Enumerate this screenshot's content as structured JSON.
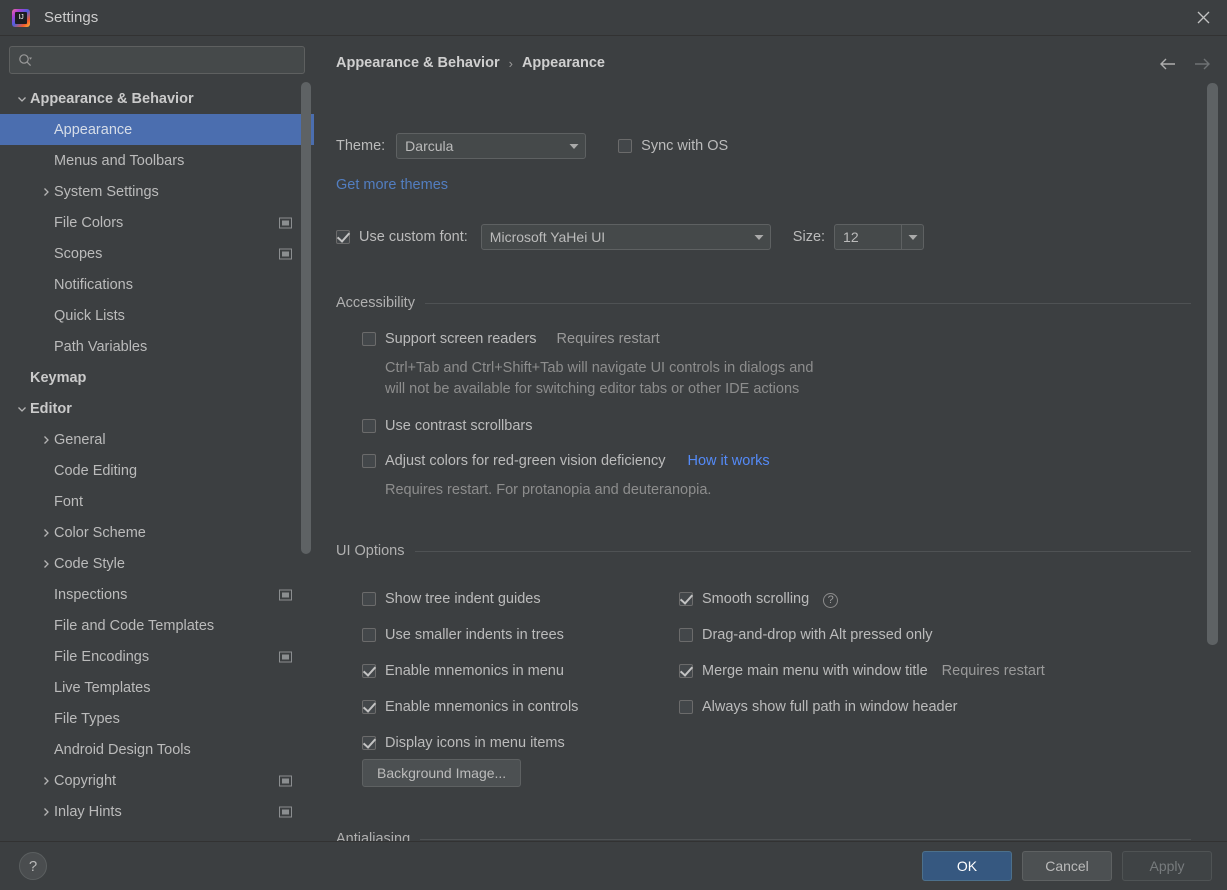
{
  "window": {
    "title": "Settings",
    "logo_text": "IJ",
    "close_icon": "close-icon"
  },
  "sidebar": {
    "search": {
      "value": "",
      "placeholder": "",
      "icon": "search-icon"
    },
    "items": [
      {
        "label": "Appearance & Behavior",
        "indent": 0,
        "bold": true,
        "twisty": "expanded",
        "selected": false,
        "project_icon": false
      },
      {
        "label": "Appearance",
        "indent": 1,
        "bold": false,
        "twisty": "none",
        "selected": true,
        "project_icon": false
      },
      {
        "label": "Menus and Toolbars",
        "indent": 1,
        "bold": false,
        "twisty": "none",
        "selected": false,
        "project_icon": false
      },
      {
        "label": "System Settings",
        "indent": 1,
        "bold": false,
        "twisty": "collapsed",
        "selected": false,
        "project_icon": false
      },
      {
        "label": "File Colors",
        "indent": 1,
        "bold": false,
        "twisty": "none",
        "selected": false,
        "project_icon": true
      },
      {
        "label": "Scopes",
        "indent": 1,
        "bold": false,
        "twisty": "none",
        "selected": false,
        "project_icon": true
      },
      {
        "label": "Notifications",
        "indent": 1,
        "bold": false,
        "twisty": "none",
        "selected": false,
        "project_icon": false
      },
      {
        "label": "Quick Lists",
        "indent": 1,
        "bold": false,
        "twisty": "none",
        "selected": false,
        "project_icon": false
      },
      {
        "label": "Path Variables",
        "indent": 1,
        "bold": false,
        "twisty": "none",
        "selected": false,
        "project_icon": false
      },
      {
        "label": "Keymap",
        "indent": 0,
        "bold": true,
        "twisty": "none",
        "selected": false,
        "project_icon": false
      },
      {
        "label": "Editor",
        "indent": 0,
        "bold": true,
        "twisty": "expanded",
        "selected": false,
        "project_icon": false
      },
      {
        "label": "General",
        "indent": 1,
        "bold": false,
        "twisty": "collapsed",
        "selected": false,
        "project_icon": false
      },
      {
        "label": "Code Editing",
        "indent": 1,
        "bold": false,
        "twisty": "none",
        "selected": false,
        "project_icon": false
      },
      {
        "label": "Font",
        "indent": 1,
        "bold": false,
        "twisty": "none",
        "selected": false,
        "project_icon": false
      },
      {
        "label": "Color Scheme",
        "indent": 1,
        "bold": false,
        "twisty": "collapsed",
        "selected": false,
        "project_icon": false
      },
      {
        "label": "Code Style",
        "indent": 1,
        "bold": false,
        "twisty": "collapsed",
        "selected": false,
        "project_icon": false
      },
      {
        "label": "Inspections",
        "indent": 1,
        "bold": false,
        "twisty": "none",
        "selected": false,
        "project_icon": true
      },
      {
        "label": "File and Code Templates",
        "indent": 1,
        "bold": false,
        "twisty": "none",
        "selected": false,
        "project_icon": false
      },
      {
        "label": "File Encodings",
        "indent": 1,
        "bold": false,
        "twisty": "none",
        "selected": false,
        "project_icon": true
      },
      {
        "label": "Live Templates",
        "indent": 1,
        "bold": false,
        "twisty": "none",
        "selected": false,
        "project_icon": false
      },
      {
        "label": "File Types",
        "indent": 1,
        "bold": false,
        "twisty": "none",
        "selected": false,
        "project_icon": false
      },
      {
        "label": "Android Design Tools",
        "indent": 1,
        "bold": false,
        "twisty": "none",
        "selected": false,
        "project_icon": false
      },
      {
        "label": "Copyright",
        "indent": 1,
        "bold": false,
        "twisty": "collapsed",
        "selected": false,
        "project_icon": true
      },
      {
        "label": "Inlay Hints",
        "indent": 1,
        "bold": false,
        "twisty": "collapsed",
        "selected": false,
        "project_icon": true
      }
    ]
  },
  "content": {
    "breadcrumb": {
      "parent": "Appearance & Behavior",
      "separator": "›",
      "current": "Appearance"
    },
    "nav": {
      "back_icon": "arrow-left-icon",
      "forward_icon": "arrow-right-icon"
    },
    "theme": {
      "label": "Theme:",
      "value": "Darcula",
      "sync_label": "Sync with OS",
      "sync_checked": false,
      "get_more_link": "Get more themes"
    },
    "font": {
      "use_custom_label": "Use custom font:",
      "use_custom_checked": true,
      "family": "Microsoft YaHei UI",
      "size_label": "Size:",
      "size_value": "12"
    },
    "accessibility": {
      "title": "Accessibility",
      "screen_readers_label": "Support screen readers",
      "screen_readers_checked": false,
      "screen_readers_note": "Requires restart",
      "screen_readers_hint_1": "Ctrl+Tab and Ctrl+Shift+Tab will navigate UI controls in dialogs and",
      "screen_readers_hint_2": "will not be available for switching editor tabs or other IDE actions",
      "contrast_scrollbars_label": "Use contrast scrollbars",
      "contrast_scrollbars_checked": false,
      "adjust_colors_label": "Adjust colors for red-green vision deficiency",
      "adjust_colors_checked": false,
      "how_it_works_link": "How it works",
      "adjust_colors_hint": "Requires restart. For protanopia and deuteranopia."
    },
    "ui_options": {
      "title": "UI Options",
      "left": [
        {
          "label": "Show tree indent guides",
          "checked": false
        },
        {
          "label": "Use smaller indents in trees",
          "checked": false
        },
        {
          "label": "Enable mnemonics in menu",
          "checked": true
        },
        {
          "label": "Enable mnemonics in controls",
          "checked": true
        },
        {
          "label": "Display icons in menu items",
          "checked": true
        }
      ],
      "right": [
        {
          "label": "Smooth scrolling",
          "checked": true,
          "help": true,
          "note": ""
        },
        {
          "label": "Drag-and-drop with Alt pressed only",
          "checked": false,
          "help": false,
          "note": ""
        },
        {
          "label": "Merge main menu with window title",
          "checked": true,
          "help": false,
          "note": "Requires restart"
        },
        {
          "label": "Always show full path in window header",
          "checked": false,
          "help": false,
          "note": ""
        }
      ],
      "background_image_button": "Background Image..."
    },
    "antialiasing": {
      "title": "Antialiasing"
    }
  },
  "footer": {
    "help_icon": "question-mark-icon",
    "ok": "OK",
    "cancel": "Cancel",
    "apply": "Apply"
  },
  "colors": {
    "background": "#3c3f41",
    "selection": "#4b6eaf",
    "link": "#527ec1",
    "primary_button": "#365880",
    "text": "#bbbbbb"
  }
}
